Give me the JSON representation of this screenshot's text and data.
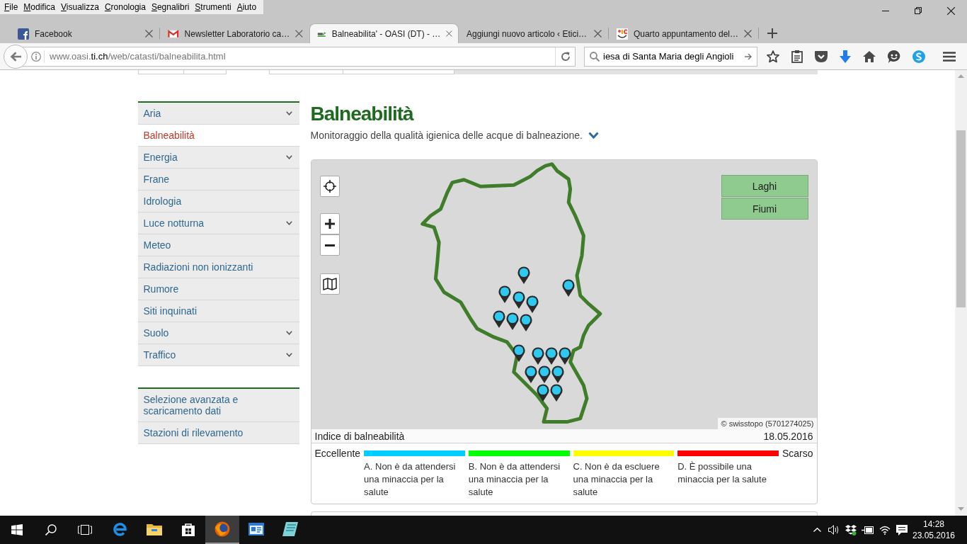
{
  "menu_bar": [
    "File",
    "Modifica",
    "Visualizza",
    "Cronologia",
    "Segnalibri",
    "Strumenti",
    "Aiuto"
  ],
  "tabs": [
    {
      "title": "Facebook",
      "selected": false
    },
    {
      "title": "Newsletter Laboratorio ca…",
      "selected": false
    },
    {
      "title": "Balneabilita' - OASI (DT) - …",
      "selected": true
    },
    {
      "title": "Aggiungi nuovo articolo ‹ Etici…",
      "selected": false
    },
    {
      "title": "Quarto appuntamento del…",
      "selected": false
    }
  ],
  "address_bar": {
    "url_prefix": "www.oasi.",
    "url_domain": "ti.ch",
    "url_path": "/web/catasti/balneabilita.html"
  },
  "search_bar": {
    "value": "iesa di Santa Maria degli Angioli"
  },
  "sidebar": {
    "items": [
      {
        "label": "Aria",
        "expandable": true,
        "selected": false
      },
      {
        "label": "Balneabilità",
        "expandable": false,
        "selected": true
      },
      {
        "label": "Energia",
        "expandable": true,
        "selected": false
      },
      {
        "label": "Frane",
        "expandable": false,
        "selected": false
      },
      {
        "label": "Idrologia",
        "expandable": false,
        "selected": false
      },
      {
        "label": "Luce notturna",
        "expandable": true,
        "selected": false
      },
      {
        "label": "Meteo",
        "expandable": false,
        "selected": false
      },
      {
        "label": "Radiazioni non ionizzanti",
        "expandable": false,
        "selected": false
      },
      {
        "label": "Rumore",
        "expandable": false,
        "selected": false
      },
      {
        "label": "Siti inquinati",
        "expandable": false,
        "selected": false
      },
      {
        "label": "Suolo",
        "expandable": true,
        "selected": false
      },
      {
        "label": "Traffico",
        "expandable": true,
        "selected": false
      }
    ],
    "links": [
      "Selezione avanzata e scaricamento dati",
      "Stazioni di rilevamento"
    ]
  },
  "page": {
    "title": "Balneabilità",
    "subtitle": "Monitoraggio della qualità igienica delle acque di balneazione."
  },
  "map": {
    "layers": [
      "Laghi",
      "Fiumi"
    ],
    "attribution": "© swisstopo (5701274025)",
    "index_title": "Indice di balneabilità",
    "date": "18.05.2016"
  },
  "legend": {
    "best_label": "Eccellente",
    "worst_label": "Scarso",
    "classes": [
      {
        "color": "#00ccff",
        "text": "A. Non è da attendersi una minaccia per la salute"
      },
      {
        "color": "#00ff00",
        "text": "B. Non è da attendersi una minaccia per la salute"
      },
      {
        "color": "#ffff00",
        "text": "C. Non è da escluere una minaccia per la salute"
      },
      {
        "color": "#ff0000",
        "text": "D. È possibile una minaccia per la salute"
      }
    ]
  },
  "taskbar": {
    "apps": [
      {
        "active": false
      },
      {
        "active": false
      },
      {
        "active": false
      },
      {
        "active": true
      },
      {
        "active": false
      },
      {
        "active": false
      }
    ],
    "time": "14:28",
    "date": "23.05.2016"
  }
}
